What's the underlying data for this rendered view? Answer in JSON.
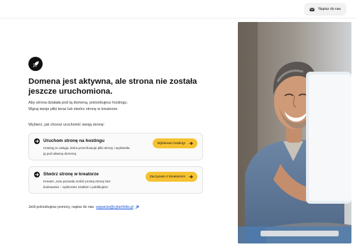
{
  "header": {
    "contact_label": "Napisz do nas",
    "contact_icon": "mail-icon"
  },
  "hero": {
    "icon": "rocket-icon",
    "headline_line1": "Domena jest aktywna, ale strona nie została",
    "headline_line2": "jeszcze uruchomiona.",
    "intro_line1": "Aby strona działała pod tą domeną, potrzebujesz hostingu.",
    "intro_line2": "Wgraj swoje pliki teraz lub stwórz stronę w kreatorze."
  },
  "choose_label": "Wybierz, jak chcesz uruchomić swoją stronę:",
  "options": [
    {
      "title": "Uruchom stronę na hostingu",
      "desc_line1": "Hosting to usługa, która przechowuje pliki strony i wyświetla",
      "desc_line2": "ją pod własną domeną.",
      "button": "Wybieram hosting!"
    },
    {
      "title": "Stwórz stronę w kreatorze",
      "desc_line1": "Kreator „now pozwala zrobić prostą stronę bez",
      "desc_line2": "kodowania – wybierasz szablon i publikujesz.",
      "button": "Zaczynam z kreatorem!"
    }
  ],
  "help": {
    "text": "Jeśli potrzebujesz pomocy, napisz do nas:",
    "email": "wsparcie@cyberfolks.pl"
  },
  "colors": {
    "accent": "#f6c232",
    "dark": "#111111",
    "link": "#1a56db"
  }
}
